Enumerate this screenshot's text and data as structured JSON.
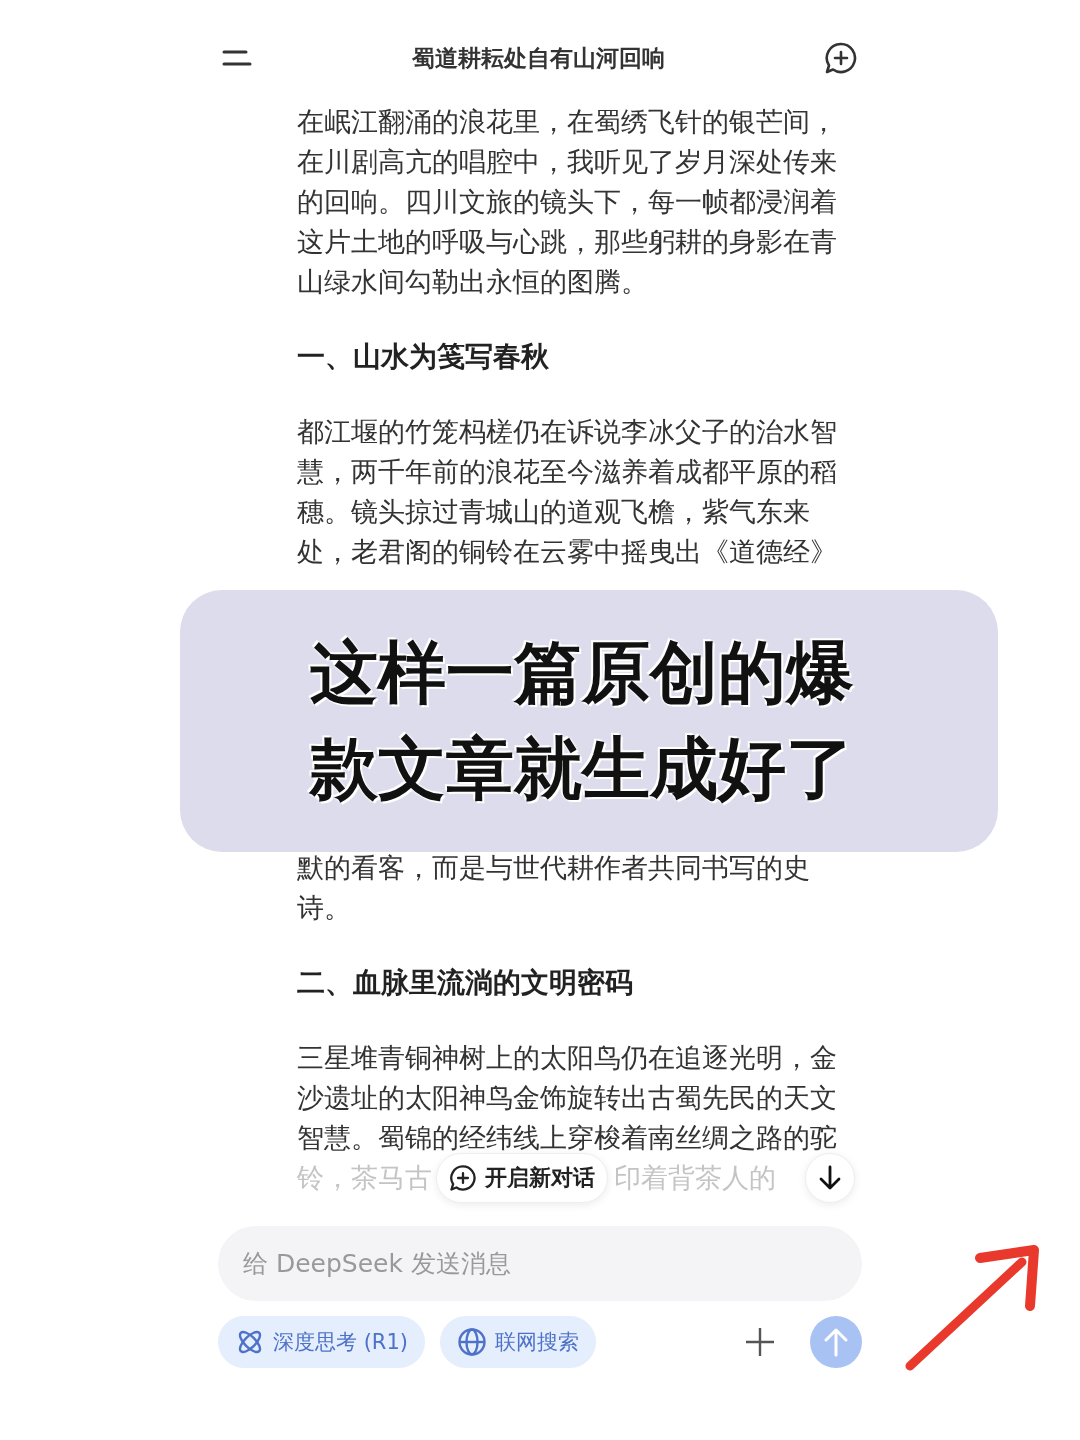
{
  "header": {
    "title": "蜀道耕耘处自有山河回响"
  },
  "article": [
    {
      "kind": "paragraph",
      "text": "在岷江翻涌的浪花里，在蜀绣飞针的银芒间，在川剧高亢的唱腔中，我听见了岁月深处传来的回响。四川文旅的镜头下，每一帧都浸润着这片土地的呼吸与心跳，那些躬耕的身影在青山绿水间勾勒出永恒的图腾。"
    },
    {
      "kind": "heading",
      "text": "一、山水为笺写春秋"
    },
    {
      "kind": "paragraph",
      "text": "都江堰的竹笼杩槎仍在诉说李冰父子的治水智慧，两千年前的浪花至今滋养着成都平原的稻穗。镜头掠过青城山的道观飞檐，紫气东来处，老君阁的铜铃在云雾中摇曳出《道德经》"
    },
    {
      "kind": "continuation",
      "text": "默的看客，而是与世代耕作者共同书写的史诗。"
    },
    {
      "kind": "heading",
      "text": "二、血脉里流淌的文明密码"
    },
    {
      "kind": "paragraph",
      "text": "三星堆青铜神树上的太阳鸟仍在追逐光明，金沙遗址的太阳神鸟金饰旋转出古蜀先民的天文智慧。蜀锦的经纬线上穿梭着南丝绸之路的驼"
    }
  ],
  "last_line": {
    "before": "铃，茶马古",
    "after": "印着背茶人的"
  },
  "new_chat_button": {
    "label": "开启新对话"
  },
  "composer": {
    "placeholder": "给 DeepSeek 发送消息"
  },
  "toggles": [
    {
      "label": "深度思考 (R1)",
      "selected": true
    },
    {
      "label": "联网搜索",
      "selected": true
    }
  ],
  "caption": {
    "text": "这样一篇原创的爆款文章就生成好了"
  }
}
